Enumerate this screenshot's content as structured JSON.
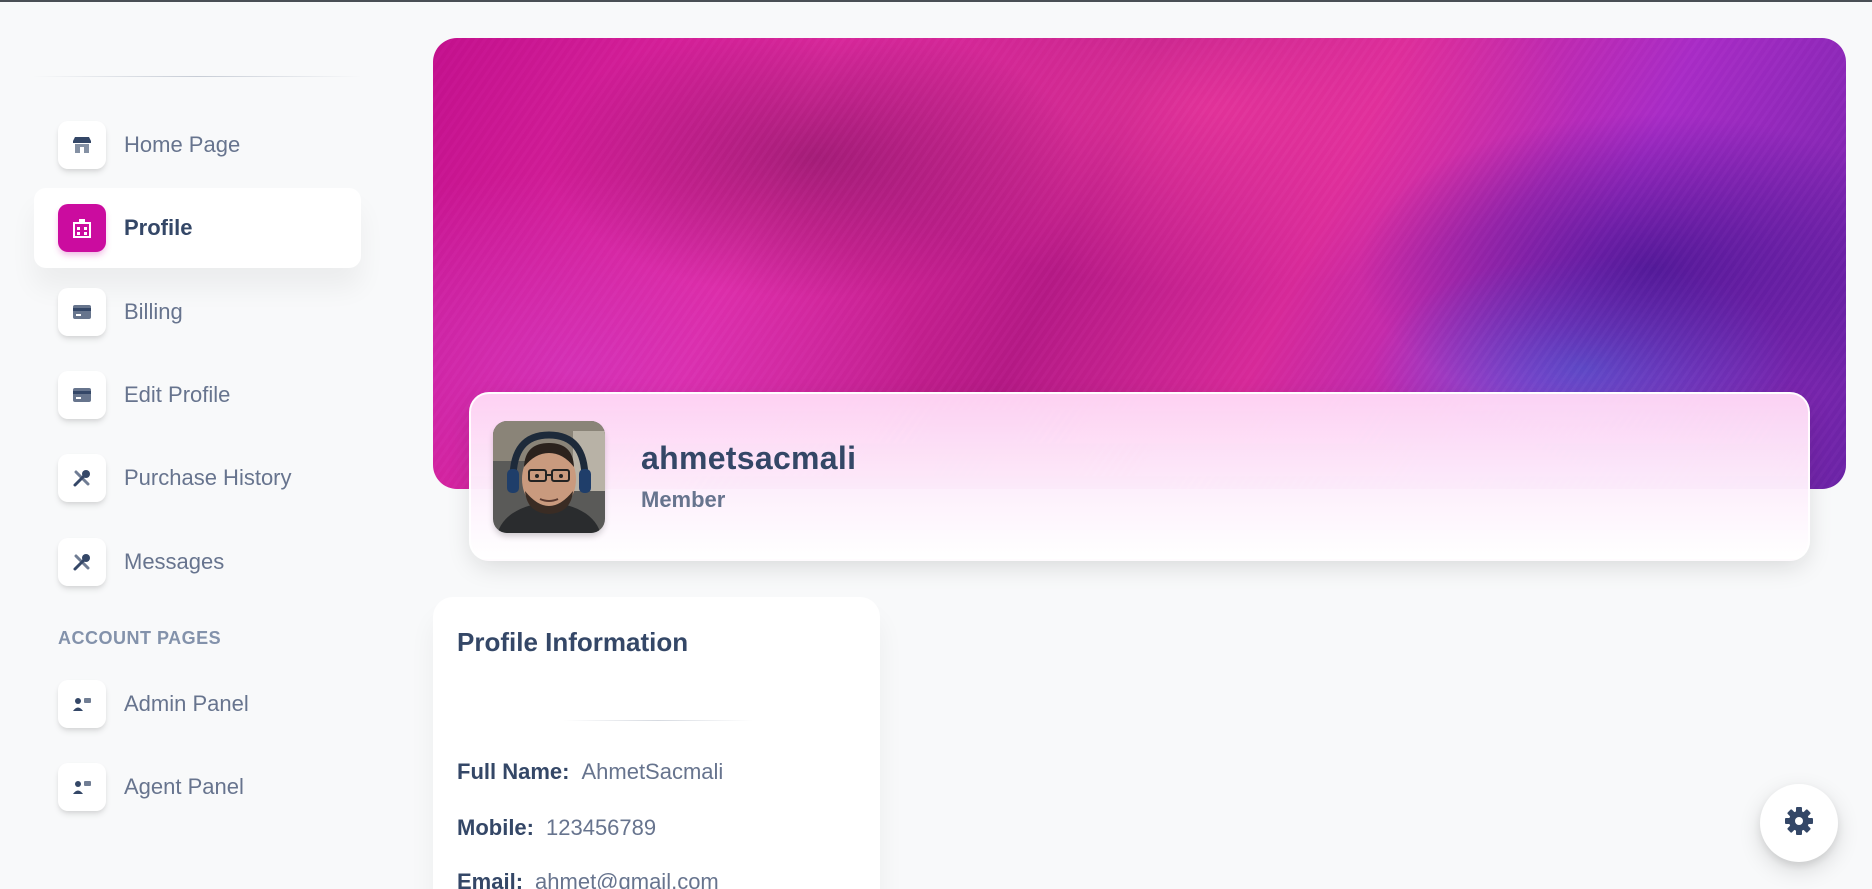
{
  "sidebar": {
    "items": [
      {
        "label": "Home Page",
        "icon": "shop-icon"
      },
      {
        "label": "Profile",
        "icon": "office-icon",
        "active": true
      },
      {
        "label": "Billing",
        "icon": "credit-card-icon"
      },
      {
        "label": "Edit Profile",
        "icon": "credit-card-icon"
      },
      {
        "label": "Purchase History",
        "icon": "tools-icon"
      },
      {
        "label": "Messages",
        "icon": "tools-icon"
      }
    ],
    "section_title": "ACCOUNT PAGES",
    "account_items": [
      {
        "label": "Admin Panel",
        "icon": "user-card-icon"
      },
      {
        "label": "Agent Panel",
        "icon": "user-card-icon"
      }
    ]
  },
  "profile": {
    "username": "ahmetsacmali",
    "role": "Member"
  },
  "info": {
    "title": "Profile Information",
    "fields": [
      {
        "key": "Full Name:",
        "value": "AhmetSacmali"
      },
      {
        "key": "Mobile:",
        "value": "123456789"
      },
      {
        "key": "Email:",
        "value": "ahmet@gmail.com"
      }
    ]
  },
  "colors": {
    "accent": "#cb0c9f",
    "text_dark": "#344767",
    "text_muted": "#67748e"
  }
}
